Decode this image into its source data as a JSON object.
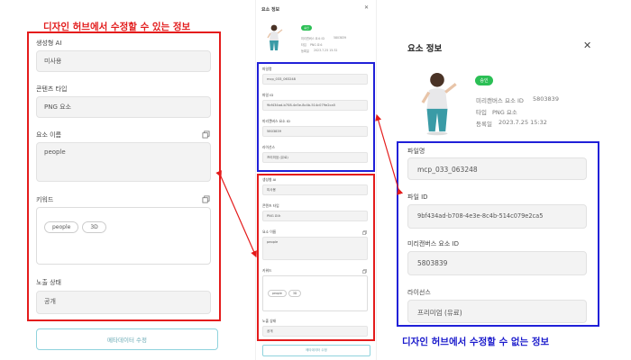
{
  "captions": {
    "editable": "디자인 허브에서 수정할 수 있는 정보",
    "non_editable": "디자인 허브에서 수정할 수 없는 정보"
  },
  "panel": {
    "title": "요소 정보",
    "close_icon": "close-icon",
    "status_badge": "승인",
    "meta": {
      "element_id_label": "미리캔버스 요소 ID",
      "element_id": "5803839",
      "type_label": "타입",
      "type": "PNG 요소",
      "registered_label": "등록일",
      "registered": "2023.7.25 15:32"
    },
    "readonly": {
      "filename_label": "파일명",
      "filename": "mcp_033_063248",
      "file_id_label": "파일 ID",
      "file_id": "9bf434ad-b708-4e3e-8c4b-514c079e2ca5",
      "element_id_label": "미리캔버스 요소 ID",
      "element_id": "5803839",
      "license_label": "라이선스",
      "license": "프리미엄 (유료)"
    },
    "editable": {
      "generated_label": "생성형 AI",
      "generated_value": "미사용",
      "content_type_label": "콘텐츠 타입",
      "content_type_value": "PNG 요소",
      "element_name_label": "요소 이름",
      "element_name_value": "people",
      "keywords_label": "키워드",
      "keywords": [
        "people",
        "3D"
      ],
      "exposure_label": "노출 상태",
      "exposure_value": "공개"
    },
    "edit_button": "메타데이터 수정"
  },
  "icons": [
    "close-icon",
    "copy-icon",
    "person-thumbnail"
  ],
  "colors": {
    "red_highlight": "#e41b1b",
    "blue_highlight": "#2020d8",
    "approved_badge": "#2bbf55",
    "button_border": "#8fd3dd"
  }
}
